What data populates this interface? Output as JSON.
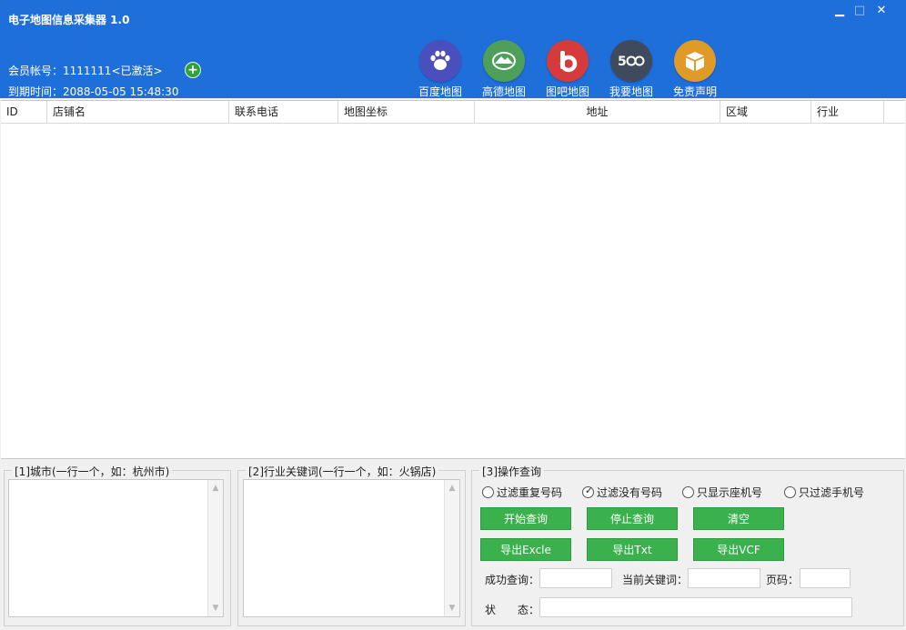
{
  "app": {
    "title": "电子地图信息采集器 1.0"
  },
  "window_controls": {
    "minimize": "▁",
    "maximize": "□",
    "close": "✕"
  },
  "account": {
    "member_text": "会员帐号：1111111<已激活>",
    "expire_text": "到期时间：2088-05-05 15:48:30",
    "add_icon": "+"
  },
  "toolbar": [
    {
      "label": "百度地图",
      "icon": "paw-icon",
      "color": "#4a4fbd"
    },
    {
      "label": "高德地图",
      "icon": "mountain-icon",
      "color": "#4e9f5a"
    },
    {
      "label": "图吧地图",
      "icon": "b-logo-icon",
      "color": "#d63b3b"
    },
    {
      "label": "我要地图",
      "icon": "500-logo-icon",
      "color": "#3f4a5c"
    },
    {
      "label": "免责声明",
      "icon": "box-icon",
      "color": "#e09a28"
    }
  ],
  "table": {
    "columns": [
      "ID",
      "店铺名",
      "联系电话",
      "地图坐标",
      "地址",
      "区域",
      "行业"
    ]
  },
  "panels": {
    "city": {
      "title": "[1]城市(一行一个，如：杭州市)"
    },
    "keyword": {
      "title": "[2]行业关键词(一行一个，如：火锅店)"
    },
    "ops": {
      "title": "[3]操作查询",
      "options": [
        {
          "label": "过滤重复号码",
          "checked": false
        },
        {
          "label": "过滤没有号码",
          "checked": true
        },
        {
          "label": "只显示座机号",
          "checked": false
        },
        {
          "label": "只过滤手机号",
          "checked": false
        }
      ],
      "buttons": {
        "start": "开始查询",
        "stop": "停止查询",
        "clear": "清空",
        "export_excel": "导出Excle",
        "export_txt": "导出Txt",
        "export_vcf": "导出VCF"
      },
      "fields": {
        "success_label": "成功查询：",
        "success_value": "",
        "keyword_label": "当前关键词：",
        "keyword_value": "",
        "page_label": "页码：",
        "page_value": "",
        "status_label": "状　　态：",
        "status_value": ""
      }
    }
  }
}
